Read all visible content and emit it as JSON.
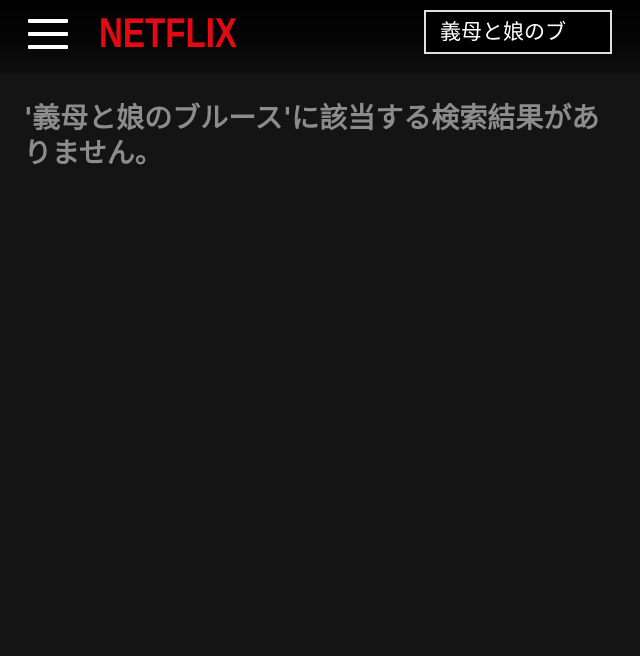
{
  "header": {
    "menu_icon": "hamburger-menu-icon",
    "logo_text": "NETFLIX",
    "logo_color": "#e50914",
    "search": {
      "value": "義母と娘のブ",
      "border_color": "#e0e0e0"
    }
  },
  "main": {
    "no_results_message": "'義母と娘のブルース'に該当する検索結果がありません。",
    "text_color": "#8c8c8c"
  },
  "colors": {
    "background": "#141414",
    "header_background": "#000000"
  }
}
